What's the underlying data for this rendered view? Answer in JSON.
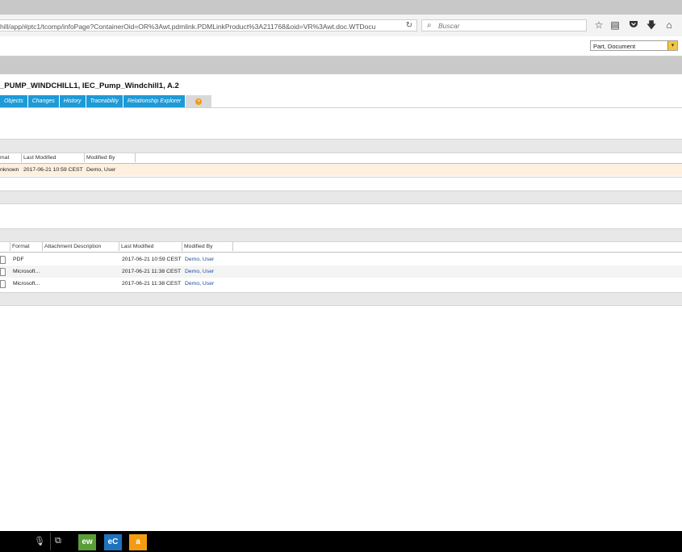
{
  "browser": {
    "url": "hill/app/#ptc1/tcomp/infoPage?ContainerOid=OR%3Awt.pdmlink.PDMLinkProduct%3A211768&oid=VR%3Awt.doc.WTDocu",
    "search_placeholder": "Buscar",
    "reload_icon": "reload-icon",
    "toolbar_icons": [
      "star-icon",
      "reading-list-icon",
      "pocket-icon",
      "download-icon",
      "home-icon"
    ]
  },
  "type_select": {
    "value": "Part, Document"
  },
  "page": {
    "title": "_PUMP_WINDCHILL1, IEC_Pump_Windchill1, A.2",
    "tabs": [
      "Objects",
      "Changes",
      "History",
      "Traceability",
      "Relationship Explorer"
    ]
  },
  "primary_table": {
    "headers": [
      "mat",
      "Last Modified",
      "Modified By"
    ],
    "rows": [
      {
        "format": "nknown",
        "last_modified": "2017-06-21 10:59 CEST",
        "modified_by": "Demo, User"
      }
    ]
  },
  "attachments_table": {
    "headers": [
      "Format",
      "Attachment Description",
      "Last Modified",
      "Modified By"
    ],
    "rows": [
      {
        "format": "PDF",
        "description": "",
        "last_modified": "2017-06-21 10:59 CEST",
        "modified_by": "Demo, User"
      },
      {
        "format": "Microsoft...",
        "description": "",
        "last_modified": "2017-06-21 11:38 CEST",
        "modified_by": "Demo, User"
      },
      {
        "format": "Microsoft...",
        "description": "",
        "last_modified": "2017-06-21 11:38 CEST",
        "modified_by": "Demo, User"
      }
    ]
  },
  "taskbar": {
    "apps": [
      {
        "name": "ew",
        "color": "#5a9e3a"
      },
      {
        "name": "eC",
        "color": "#1e73be"
      },
      {
        "name": "a",
        "color": "#f39c12"
      }
    ]
  }
}
